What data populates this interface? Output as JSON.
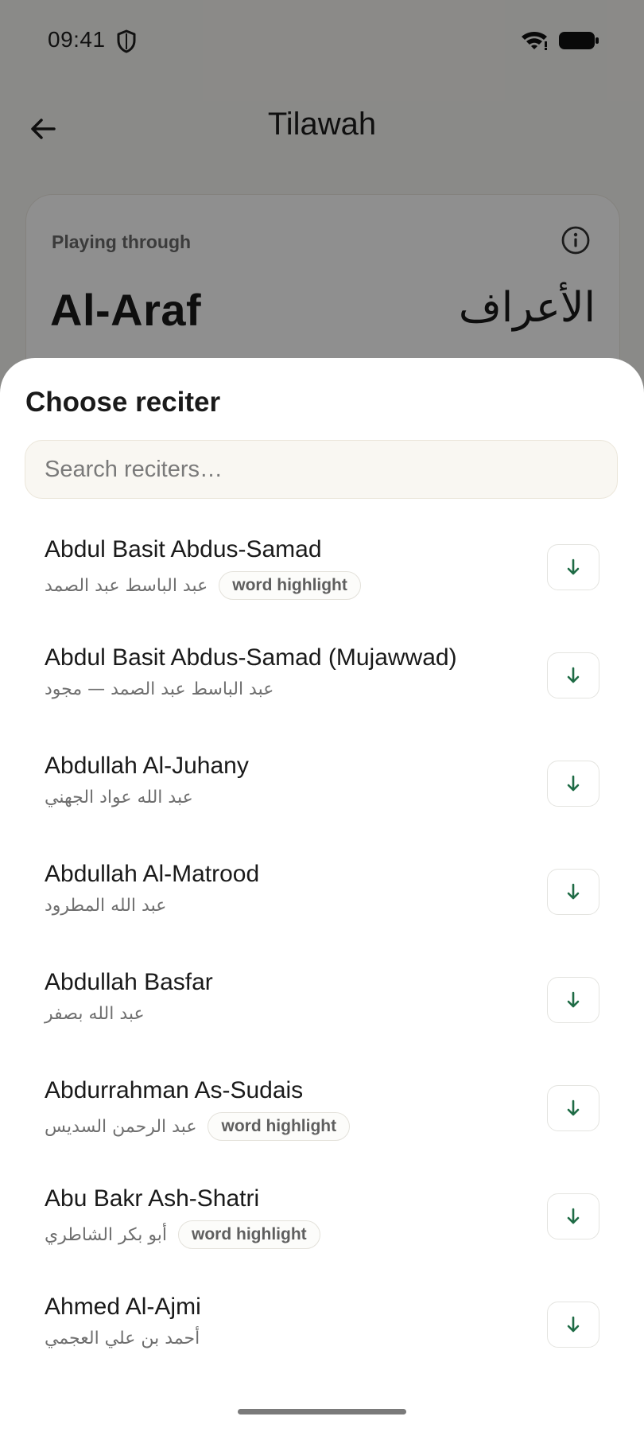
{
  "status_bar": {
    "time": "09:41",
    "icons": [
      "shield-icon",
      "wifi-icon",
      "battery-icon"
    ]
  },
  "appbar": {
    "title": "Tilawah",
    "back_icon": "arrow-left-icon"
  },
  "now_playing": {
    "label": "Playing through",
    "surah_name": "Al-Araf",
    "surah_arabic": "الأعراف",
    "info_icon": "info-icon"
  },
  "sheet": {
    "title": "Choose reciter",
    "search_placeholder": "Search reciters…",
    "search_value": "",
    "reciters": [
      {
        "name": "Abdul Basit Abdus-Samad",
        "arabic": "عبد الباسط عبد الصمد",
        "badge": "word highlight"
      },
      {
        "name": "Abdul Basit Abdus-Samad (Mujawwad)",
        "arabic": "عبد الباسط عبد الصمد — مجود",
        "badge": ""
      },
      {
        "name": "Abdullah Al-Juhany",
        "arabic": "عبد الله عواد الجهني",
        "badge": ""
      },
      {
        "name": "Abdullah Al-Matrood",
        "arabic": "عبد الله المطرود",
        "badge": ""
      },
      {
        "name": "Abdullah Basfar",
        "arabic": "عبد الله بصفر",
        "badge": ""
      },
      {
        "name": "Abdurrahman As-Sudais",
        "arabic": "عبد الرحمن السديس",
        "badge": "word highlight"
      },
      {
        "name": "Abu Bakr Ash-Shatri",
        "arabic": "أبو بكر الشاطري",
        "badge": "word highlight"
      },
      {
        "name": "Ahmed Al-Ajmi",
        "arabic": "أحمد بن علي العجمي",
        "badge": ""
      }
    ],
    "download_icon": "arrow-down-icon"
  },
  "colors": {
    "accent": "#1e6b45",
    "scrim": "rgba(0,0,0,0.44)",
    "sheet": "#ffffff",
    "search_bg": "#f9f7f2"
  }
}
